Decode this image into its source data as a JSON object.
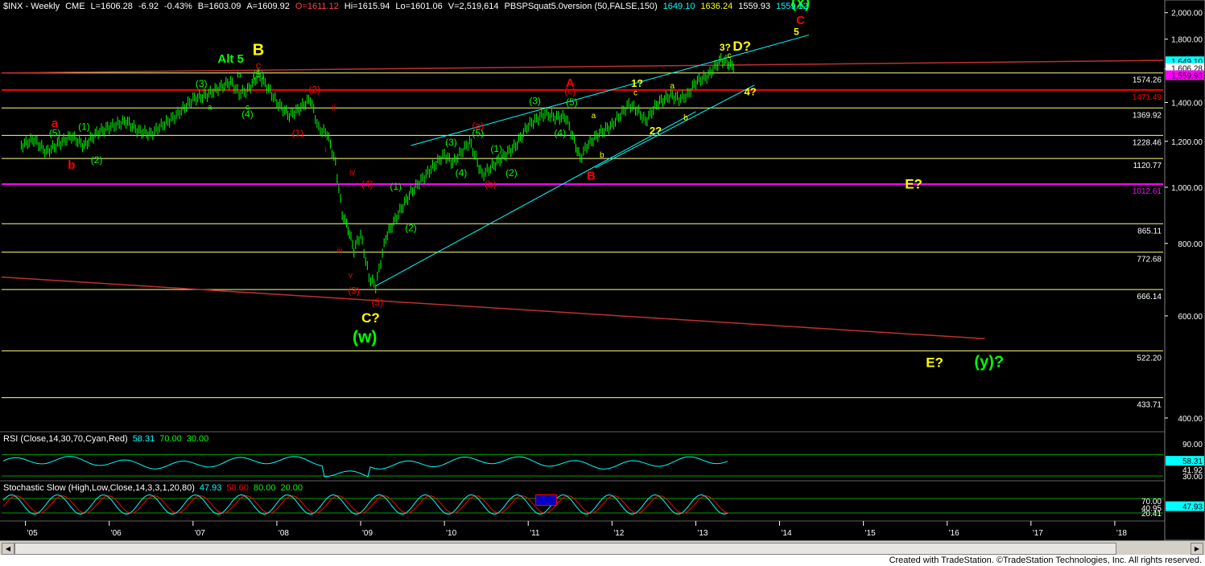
{
  "header": {
    "symbol": "$INX - Weekly",
    "exchange": "CME",
    "last": "L=1606.28",
    "change": "-6.92",
    "change_pct": "-0.43%",
    "bid": "B=1603.09",
    "ask": "A=1609.92",
    "open": "O=1611.12",
    "high": "Hi=1615.94",
    "low": "Lo=1601.06",
    "volume": "V=2,519,614",
    "study": "PBSPSquat5.0version (50,FALSE,150)",
    "study_vals": [
      {
        "text": "1649.10",
        "color": "#00ffff"
      },
      {
        "text": "1636.24",
        "color": "#ffff00"
      },
      {
        "text": "1559.93",
        "color": "#ffffff"
      },
      {
        "text": "1559.12",
        "color": "#00ffff"
      }
    ]
  },
  "colors": {
    "bars": "#00ff00",
    "yellow_line": "#ffff80",
    "red_line": "#ff0000",
    "magenta_line": "#ff00ff",
    "channel": "#00ffff",
    "label_green": "#00ff00",
    "label_red": "#ff0000",
    "label_yellow": "#ffff00"
  },
  "chart_data": {
    "type": "line",
    "title": "$INX - Weekly",
    "price_scale": "log",
    "ylim": [
      380,
      2050
    ],
    "x_ticks": [
      "'05",
      "'06",
      "'07",
      "'08",
      "'09",
      "'10",
      "'11",
      "'12",
      "'13",
      "'14",
      "'15",
      "'16",
      "'17",
      "'18"
    ],
    "y_ticks": [
      "2,000.00",
      "1,800.00",
      "1,600.00",
      "1,400.00",
      "1,200.00",
      "1,000.00",
      "800.00",
      "600.00",
      "400.00"
    ],
    "x_units": "years",
    "series": [
      {
        "x": [
          2004.95,
          2005.1,
          2005.25,
          2005.4,
          2005.55,
          2005.7,
          2005.85,
          2006.0,
          2006.2,
          2006.35,
          2006.5,
          2006.6,
          2006.8,
          2007.0,
          2007.15,
          2007.3,
          2007.45,
          2007.55,
          2007.65,
          2007.78,
          2007.9,
          2008.0,
          2008.15,
          2008.25,
          2008.4,
          2008.5,
          2008.6,
          2008.7,
          2008.78,
          2008.85,
          2008.92,
          2009.0,
          2009.1,
          2009.18,
          2009.3,
          2009.45,
          2009.6,
          2009.8,
          2010.0,
          2010.1,
          2010.3,
          2010.45,
          2010.55,
          2010.7,
          2010.85,
          2011.0,
          2011.2,
          2011.32,
          2011.45,
          2011.55,
          2011.62,
          2011.7,
          2011.85,
          2012.0,
          2012.2,
          2012.3,
          2012.4,
          2012.55,
          2012.7,
          2012.8,
          2012.9,
          2013.0,
          2013.15,
          2013.3,
          2013.38,
          2013.45
        ],
        "y": [
          1180,
          1210,
          1150,
          1190,
          1225,
          1180,
          1240,
          1270,
          1300,
          1250,
          1235,
          1270,
          1330,
          1420,
          1440,
          1480,
          1520,
          1450,
          1470,
          1560,
          1480,
          1400,
          1330,
          1360,
          1420,
          1260,
          1240,
          1100,
          900,
          850,
          780,
          830,
          700,
          676,
          820,
          900,
          980,
          1060,
          1140,
          1100,
          1200,
          1050,
          1080,
          1130,
          1180,
          1280,
          1340,
          1320,
          1320,
          1200,
          1120,
          1180,
          1240,
          1280,
          1390,
          1360,
          1300,
          1400,
          1440,
          1420,
          1440,
          1520,
          1560,
          1660,
          1640,
          1606
        ]
      }
    ],
    "horizontal_levels": [
      {
        "label": "1574.26",
        "value": 1574.26,
        "color": "#ffffff"
      },
      {
        "label": "1471.49",
        "value": 1471.49,
        "color": "#ff0000"
      },
      {
        "label": "1369.92",
        "value": 1369.92,
        "color": "#ffffff"
      },
      {
        "label": "1228.46",
        "value": 1228.46,
        "color": "#ffffff"
      },
      {
        "label": "1120.77",
        "value": 1120.77,
        "color": "#ffffff"
      },
      {
        "label": "1012.61",
        "value": 1012.61,
        "color": "#ff00ff"
      },
      {
        "label": "865.11",
        "value": 865.11,
        "color": "#ffffff"
      },
      {
        "label": "772.68",
        "value": 772.68,
        "color": "#ffffff"
      },
      {
        "label": "666.14",
        "value": 666.14,
        "color": "#ffffff"
      },
      {
        "label": "522.20",
        "value": 522.2,
        "color": "#ffffff"
      },
      {
        "label": "433.71",
        "value": 433.71,
        "color": "#ffffff"
      }
    ],
    "price_tags": [
      {
        "label": "1,649.10",
        "value": 1649.1,
        "bg": "#00ffff"
      },
      {
        "label": "1,606.28",
        "value": 1606.28,
        "bg": "#ffffff"
      },
      {
        "label": "1,559.93",
        "value": 1559.93,
        "bg": "#ff00ff"
      }
    ],
    "wave_labels": [
      {
        "t": "(x)",
        "x": 2014.25,
        "y": 2040,
        "c": "#00ff00",
        "s": 19,
        "b": true
      },
      {
        "t": "C",
        "x": 2014.25,
        "y": 1910,
        "c": "#ff0000",
        "s": 15,
        "b": true
      },
      {
        "t": "5",
        "x": 2014.2,
        "y": 1830,
        "c": "#ffff00",
        "s": 12,
        "b": true
      },
      {
        "t": "D?",
        "x": 2013.55,
        "y": 1720,
        "c": "#ffff00",
        "s": 17,
        "b": true
      },
      {
        "t": "3?",
        "x": 2013.35,
        "y": 1720,
        "c": "#ffff00",
        "s": 12,
        "b": true
      },
      {
        "t": "c",
        "x": 2013.4,
        "y": 1670,
        "c": "#ffff00",
        "s": 10,
        "b": false
      },
      {
        "t": "4?",
        "x": 2013.65,
        "y": 1440,
        "c": "#ffff00",
        "s": 13,
        "b": true
      },
      {
        "t": "1?",
        "x": 2012.3,
        "y": 1490,
        "c": "#ffff00",
        "s": 13,
        "b": true
      },
      {
        "t": "c",
        "x": 2012.28,
        "y": 1440,
        "c": "#ffff00",
        "s": 10,
        "b": false
      },
      {
        "t": "a",
        "x": 2012.72,
        "y": 1480,
        "c": "#ffff00",
        "s": 10,
        "b": false
      },
      {
        "t": "b",
        "x": 2012.88,
        "y": 1305,
        "c": "#ffff00",
        "s": 10,
        "b": false
      },
      {
        "t": "2?",
        "x": 2012.52,
        "y": 1235,
        "c": "#ffff00",
        "s": 13,
        "b": true
      },
      {
        "t": "a",
        "x": 2011.78,
        "y": 1315,
        "c": "#ffff00",
        "s": 10,
        "b": false
      },
      {
        "t": "b",
        "x": 2011.88,
        "y": 1125,
        "c": "#ffff00",
        "s": 10,
        "b": false
      },
      {
        "t": "B",
        "x": 2011.75,
        "y": 1030,
        "c": "#ff0000",
        "s": 15,
        "b": true
      },
      {
        "t": "A",
        "x": 2011.5,
        "y": 1490,
        "c": "#ff0000",
        "s": 15,
        "b": true
      },
      {
        "t": "(c)",
        "x": 2011.5,
        "y": 1445,
        "c": "#ff0000",
        "s": 12,
        "b": false
      },
      {
        "t": "(5)",
        "x": 2011.52,
        "y": 1385,
        "c": "#00ff00",
        "s": 12,
        "b": false
      },
      {
        "t": "(4)",
        "x": 2011.38,
        "y": 1225,
        "c": "#00ff00",
        "s": 12,
        "b": false
      },
      {
        "t": "(3)",
        "x": 2011.08,
        "y": 1390,
        "c": "#00ff00",
        "s": 12,
        "b": false
      },
      {
        "t": "(a)",
        "x": 2010.4,
        "y": 1260,
        "c": "#ff0000",
        "s": 12,
        "b": false
      },
      {
        "t": "(5)",
        "x": 2010.4,
        "y": 1225,
        "c": "#00ff00",
        "s": 12,
        "b": false
      },
      {
        "t": "(3)",
        "x": 2010.08,
        "y": 1180,
        "c": "#00ff00",
        "s": 12,
        "b": false
      },
      {
        "t": "(4)",
        "x": 2010.2,
        "y": 1045,
        "c": "#00ff00",
        "s": 12,
        "b": false
      },
      {
        "t": "(b)",
        "x": 2010.55,
        "y": 1000,
        "c": "#ff0000",
        "s": 12,
        "b": false
      },
      {
        "t": "(1)",
        "x": 2010.62,
        "y": 1150,
        "c": "#00ff00",
        "s": 12,
        "b": false
      },
      {
        "t": "(2)",
        "x": 2010.8,
        "y": 1045,
        "c": "#00ff00",
        "s": 12,
        "b": false
      },
      {
        "t": "(1)",
        "x": 2009.42,
        "y": 990,
        "c": "#00ff00",
        "s": 12,
        "b": false
      },
      {
        "t": "(2)",
        "x": 2009.6,
        "y": 840,
        "c": "#00ff00",
        "s": 12,
        "b": false
      },
      {
        "t": "(4)",
        "x": 2009.08,
        "y": 1000,
        "c": "#ff0000",
        "s": 12,
        "b": false
      },
      {
        "t": "iv",
        "x": 2008.9,
        "y": 1050,
        "c": "#ff0000",
        "s": 10,
        "b": false
      },
      {
        "t": "iii",
        "x": 2008.75,
        "y": 770,
        "c": "#ff0000",
        "s": 10,
        "b": false
      },
      {
        "t": "v",
        "x": 2008.88,
        "y": 698,
        "c": "#ff0000",
        "s": 10,
        "b": false
      },
      {
        "t": "(3)",
        "x": 2008.92,
        "y": 655,
        "c": "#ff0000",
        "s": 12,
        "b": false
      },
      {
        "t": "(5)",
        "x": 2009.2,
        "y": 625,
        "c": "#ff0000",
        "s": 12,
        "b": false
      },
      {
        "t": "C?",
        "x": 2009.12,
        "y": 585,
        "c": "#ffff00",
        "s": 17,
        "b": true
      },
      {
        "t": "(w)",
        "x": 2009.05,
        "y": 540,
        "c": "#00ff00",
        "s": 21,
        "b": true
      },
      {
        "t": "(2)",
        "x": 2008.45,
        "y": 1455,
        "c": "#ff0000",
        "s": 12,
        "b": false
      },
      {
        "t": "ii",
        "x": 2008.68,
        "y": 1355,
        "c": "#ff0000",
        "s": 10,
        "b": false
      },
      {
        "t": "i",
        "x": 2008.58,
        "y": 1150,
        "c": "#ff0000",
        "s": 10,
        "b": false
      },
      {
        "t": "(1)",
        "x": 2008.25,
        "y": 1225,
        "c": "#ff0000",
        "s": 12,
        "b": false
      },
      {
        "t": "B",
        "x": 2007.78,
        "y": 1690,
        "c": "#ffff00",
        "s": 20,
        "b": true
      },
      {
        "t": "c",
        "x": 2007.78,
        "y": 1600,
        "c": "#ff0000",
        "s": 13,
        "b": false
      },
      {
        "t": "(5)",
        "x": 2007.78,
        "y": 1545,
        "c": "#00ff00",
        "s": 12,
        "b": false
      },
      {
        "t": "Alt 5",
        "x": 2007.45,
        "y": 1640,
        "c": "#00ff00",
        "s": 15,
        "b": true
      },
      {
        "t": "b",
        "x": 2007.55,
        "y": 1545,
        "c": "#00ff00",
        "s": 10,
        "b": false
      },
      {
        "t": "(3)",
        "x": 2007.1,
        "y": 1490,
        "c": "#00ff00",
        "s": 12,
        "b": false
      },
      {
        "t": "a",
        "x": 2007.2,
        "y": 1360,
        "c": "#00ff00",
        "s": 10,
        "b": false
      },
      {
        "t": "c",
        "x": 2007.65,
        "y": 1360,
        "c": "#00ff00",
        "s": 10,
        "b": false
      },
      {
        "t": "(4)",
        "x": 2007.65,
        "y": 1320,
        "c": "#00ff00",
        "s": 12,
        "b": false
      },
      {
        "t": "(1)",
        "x": 2005.7,
        "y": 1255,
        "c": "#00ff00",
        "s": 12,
        "b": false
      },
      {
        "t": "(2)",
        "x": 2005.85,
        "y": 1100,
        "c": "#00ff00",
        "s": 12,
        "b": false
      },
      {
        "t": "a",
        "x": 2005.35,
        "y": 1270,
        "c": "#ff0000",
        "s": 15,
        "b": true
      },
      {
        "t": "(5)",
        "x": 2005.35,
        "y": 1225,
        "c": "#00ff00",
        "s": 12,
        "b": false
      },
      {
        "t": "b",
        "x": 2005.55,
        "y": 1075,
        "c": "#ff0000",
        "s": 15,
        "b": true
      },
      {
        "t": "E?",
        "x": 2015.6,
        "y": 995,
        "c": "#ffff00",
        "s": 17,
        "b": true
      },
      {
        "t": "E?",
        "x": 2015.85,
        "y": 490,
        "c": "#ffff00",
        "s": 17,
        "b": true
      },
      {
        "t": "(y)?",
        "x": 2016.5,
        "y": 490,
        "c": "#00ff00",
        "s": 20,
        "b": true
      }
    ],
    "rsi": {
      "label": "RSI (Close,14,30,70,Cyan,Red)",
      "value": "58.31",
      "levels": [
        "70.00",
        "30.00"
      ],
      "axis": [
        "90.00",
        "41.92",
        "30.00"
      ],
      "tag": "58.31"
    },
    "stoch": {
      "label": "Stochastic Slow (High,Low,Close,14,3,3,1,20,80)",
      "values": [
        "47.93",
        "58.60",
        "80.00",
        "20.00"
      ],
      "axis": [
        "40.95",
        "20.41",
        "70.00"
      ],
      "tag": "47.93"
    }
  },
  "footer": {
    "text": "Created with TradeStation. ©TradeStation Technologies, Inc. All rights reserved."
  }
}
